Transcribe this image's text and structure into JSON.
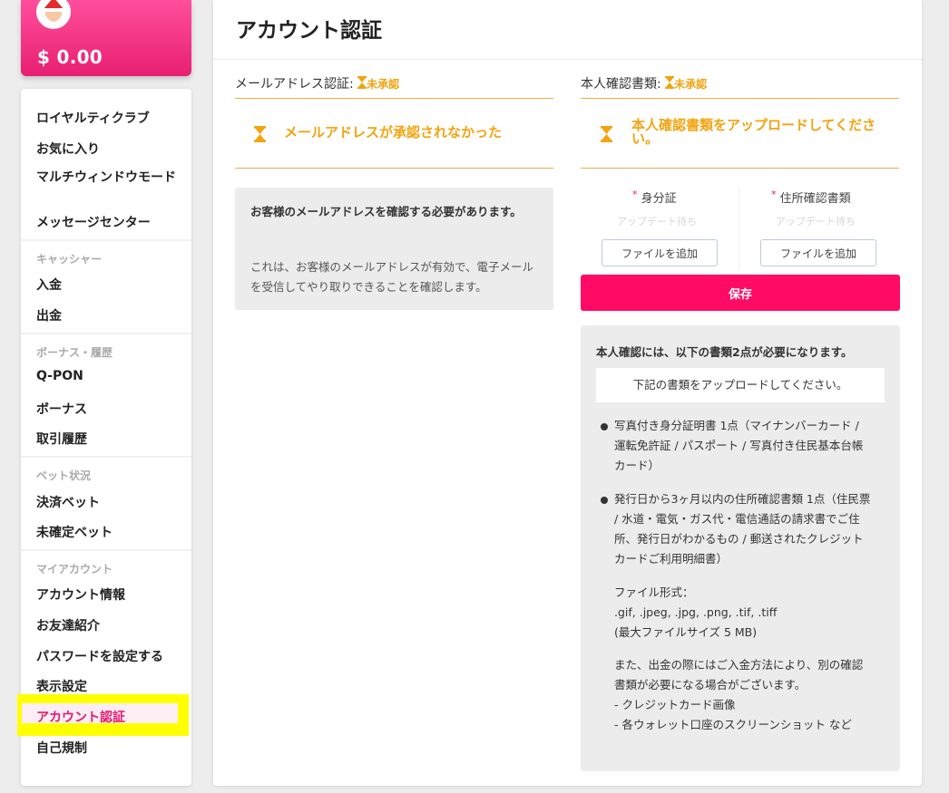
{
  "sidebar": {
    "balance": "$ 0.00",
    "items": [
      {
        "label": "ロイヤルティクラブ"
      },
      {
        "label": "お気に入り"
      },
      {
        "label": "マルチウィンドウモード"
      },
      {
        "label": "メッセージセンター"
      }
    ],
    "sections": [
      {
        "title": "キャッシャー",
        "items": [
          "入金",
          "出金"
        ]
      },
      {
        "title": "ボーナス・履歴",
        "items": [
          "Q-PON",
          "ボーナス",
          "取引履歴"
        ]
      },
      {
        "title": "ベット状況",
        "items": [
          "決済ベット",
          "未確定ベット"
        ]
      },
      {
        "title": "マイアカウント",
        "items": [
          "アカウント情報",
          "お友達紹介",
          "パスワードを設定する",
          "表示設定",
          "アカウント認証",
          "自己規制"
        ]
      }
    ]
  },
  "main": {
    "title": "アカウント認証",
    "email_section": {
      "heading": "メールアドレス認証:",
      "status": "未承認",
      "warning": "メールアドレスが承認されなかった",
      "info_bold": "お客様のメールアドレスを確認する必要があります。",
      "info_text": "これは、お客様のメールアドレスが有効で、電子メールを受信してやり取りできることを確認します。"
    },
    "doc_section": {
      "heading": "本人確認書類:",
      "status": "未承認",
      "warning": "本人確認書類をアップロードしてください。",
      "documents": [
        {
          "label": "身分証",
          "status": "アップデート待ち",
          "button": "ファイルを追加"
        },
        {
          "label": "住所確認書類",
          "status": "アップデート待ち",
          "button": "ファイルを追加"
        }
      ],
      "save_label": "保存",
      "requirements": {
        "title": "本人確認には、以下の書類2点が必要になります。",
        "note": "下記の書類をアップロードしてください。",
        "item1": "写真付き身分証明書 1点（マイナンバーカード / 運転免許証 / パスポート / 写真付き住民基本台帳カード）",
        "item2": "発行日から3ヶ月以内の住所確認書類 1点（住民票 / 水道・電気・ガス代・電信通話の請求書でご住所、発行日がわかるもの / 郵送されたクレジットカードご利用明細書）",
        "formats_label": "ファイル形式：",
        "formats": ".gif, .jpeg, .jpg, .png, .tif, .tiff",
        "max_size": "(最大ファイルサイズ 5 MB)",
        "extra": "また、出金の際にはご入金方法により、別の確認書類が必要になる場合がございます。",
        "extra_item1": "- クレジットカード画像",
        "extra_item2": "- 各ウォレット口座のスクリーンショット など"
      }
    }
  },
  "colors": {
    "brand": "#ff0a64",
    "warning": "#f2a30f",
    "highlight": "#ffff00"
  }
}
